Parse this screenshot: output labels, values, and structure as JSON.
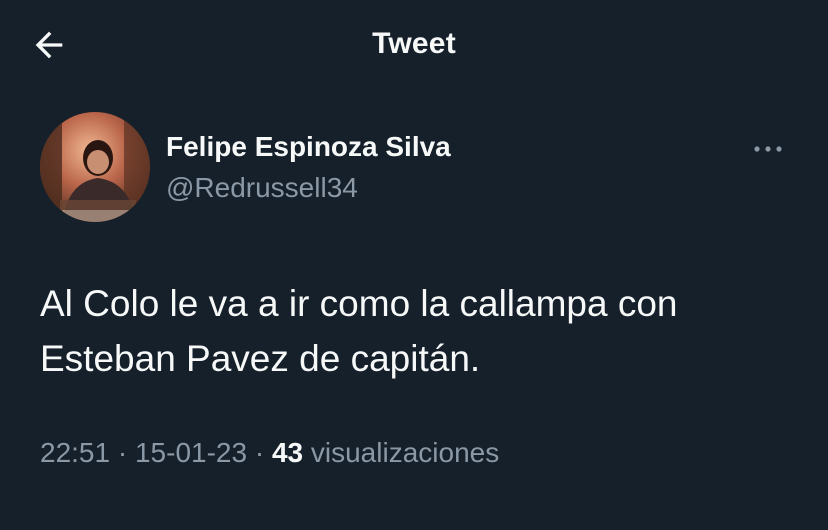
{
  "header": {
    "title": "Tweet",
    "back_icon": "arrow-left-icon"
  },
  "tweet": {
    "author_name": "Felipe Espinoza Silva",
    "author_handle": "@Redrussell34",
    "more_icon": "more-horizontal-icon",
    "text": "Al Colo le va a ir como la callampa con Esteban Pavez de capitán.",
    "time": "22:51",
    "date": "15-01-23",
    "separator": "·",
    "views_count": "43",
    "views_label": "visualizaciones"
  },
  "colors": {
    "background": "#15202b",
    "primary_text": "#f7f9f9",
    "secondary_text": "#8b98a5"
  }
}
